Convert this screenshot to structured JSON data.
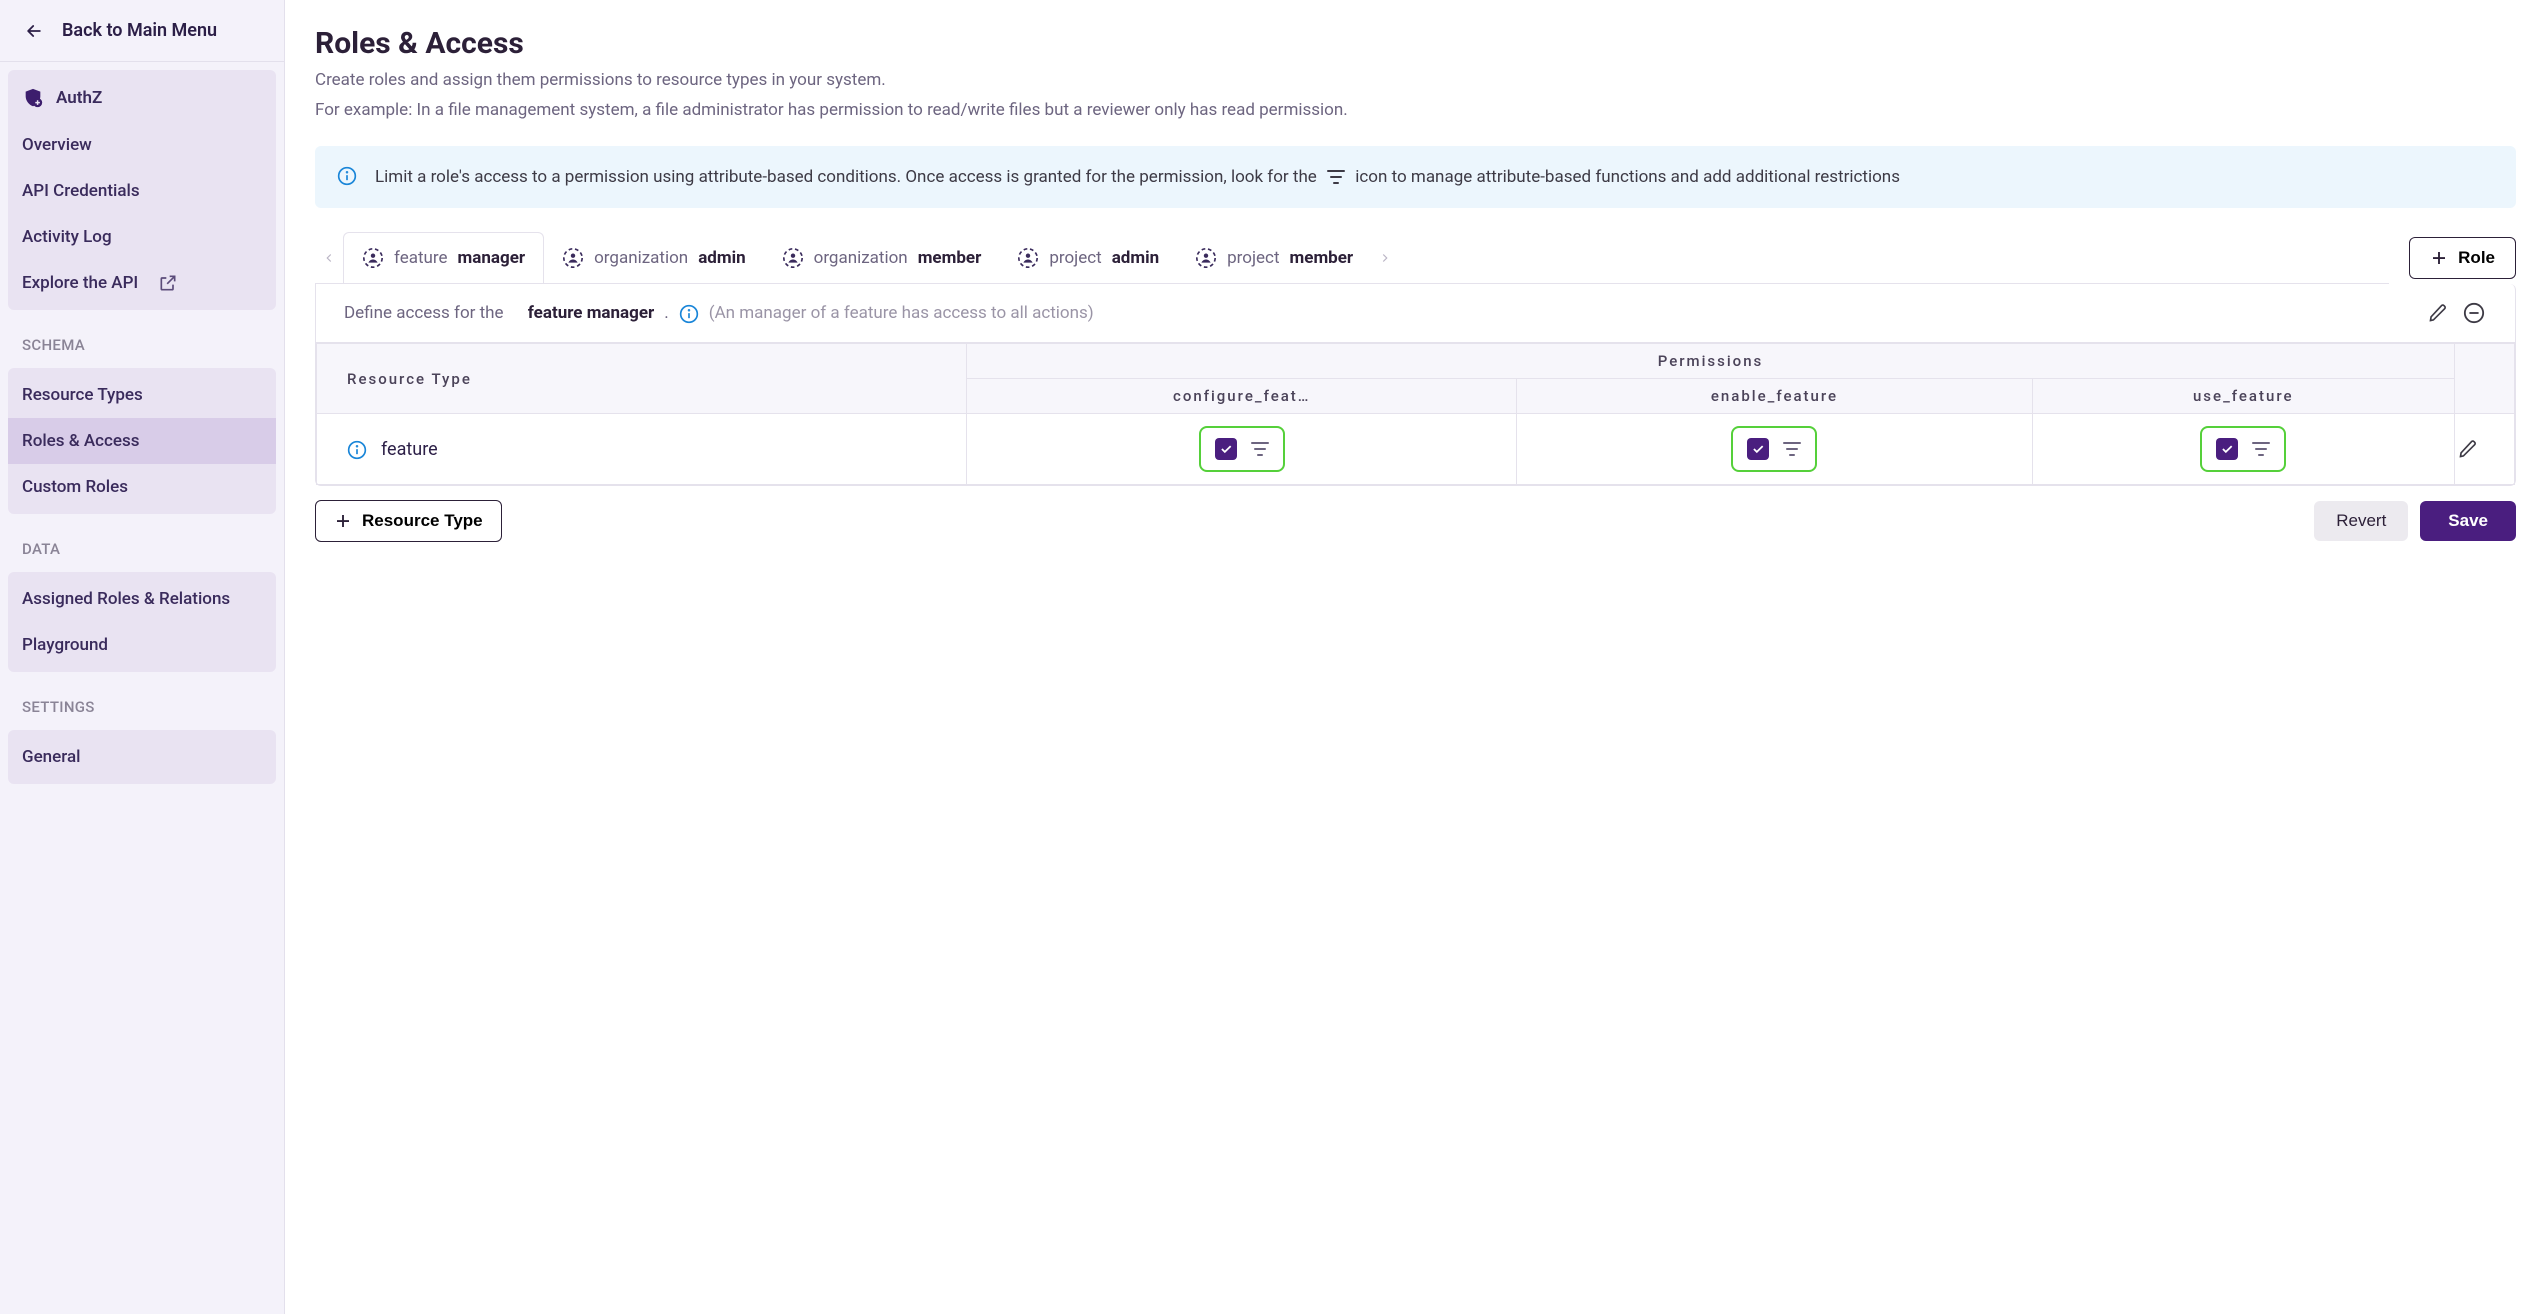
{
  "sidebar": {
    "back_label": "Back to Main Menu",
    "product_label": "AuthZ",
    "main_items": [
      {
        "label": "Overview"
      },
      {
        "label": "API Credentials"
      },
      {
        "label": "Activity Log"
      },
      {
        "label": "Explore the API",
        "external": true
      }
    ],
    "groups": [
      {
        "label": "SCHEMA",
        "items": [
          {
            "label": "Resource Types"
          },
          {
            "label": "Roles & Access",
            "active": true
          },
          {
            "label": "Custom Roles"
          }
        ]
      },
      {
        "label": "DATA",
        "items": [
          {
            "label": "Assigned Roles & Relations"
          },
          {
            "label": "Playground"
          }
        ]
      },
      {
        "label": "SETTINGS",
        "items": [
          {
            "label": "General"
          }
        ]
      }
    ]
  },
  "page": {
    "title": "Roles & Access",
    "subtitle_1": "Create roles and assign them permissions to resource types in your system.",
    "subtitle_2": "For example: In a file management system, a file administrator has permission to read/write files but a reviewer only has read permission."
  },
  "banner": {
    "text_before": "Limit a role's access to a permission using attribute-based conditions. Once access is granted for the permission, look for the",
    "text_after": "icon to manage attribute-based functions and add additional restrictions"
  },
  "tabs": [
    {
      "resource": "feature",
      "role": "manager",
      "active": true
    },
    {
      "resource": "organization",
      "role": "admin"
    },
    {
      "resource": "organization",
      "role": "member"
    },
    {
      "resource": "project",
      "role": "admin"
    },
    {
      "resource": "project",
      "role": "member"
    }
  ],
  "add_role_label": "Role",
  "card": {
    "define_prefix": "Define access for the",
    "role_name": "feature manager",
    "description": "(An manager of a feature has access to all actions)"
  },
  "table": {
    "resource_header": "Resource Type",
    "permissions_header": "Permissions",
    "permission_columns": [
      "configure_feat…",
      "enable_feature",
      "use_feature"
    ],
    "rows": [
      {
        "resource": "feature",
        "perms": [
          true,
          true,
          true
        ]
      }
    ]
  },
  "footer": {
    "add_resource_label": "Resource Type",
    "revert_label": "Revert",
    "save_label": "Save"
  }
}
